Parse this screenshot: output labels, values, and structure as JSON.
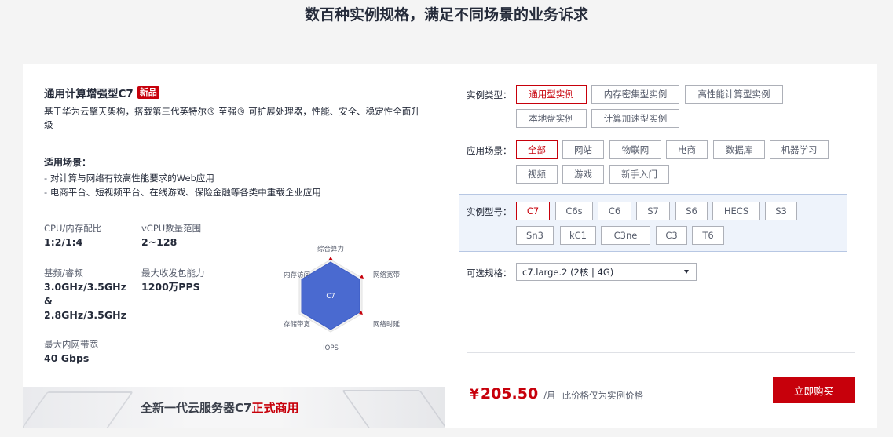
{
  "page_title": "数百种实例规格，满足不同场景的业务诉求",
  "product": {
    "title": "通用计算增强型C7",
    "badge": "新品",
    "description": "基于华为云擎天架构，搭载第三代英特尔® 至强® 可扩展处理器，性能、安全、稳定性全面升级",
    "scenario_title": "适用场景：",
    "scenarios": [
      "对计算与网络有较高性能要求的Web应用",
      "电商平台、短视频平台、在线游戏、保险金融等各类中重载企业应用"
    ],
    "specs": [
      {
        "key": "CPU/内存配比",
        "value": "1:2/1:4"
      },
      {
        "key": "vCPU数量范围",
        "value": "2~128"
      },
      {
        "key": "基频/睿频",
        "value": "3.0GHz/3.5GHz & 2.8GHz/3.5GHz"
      },
      {
        "key": "最大收发包能力",
        "value": "1200万PPS"
      },
      {
        "key": "最大内网带宽",
        "value": "40 Gbps"
      }
    ],
    "radar": {
      "center_label": "C7",
      "axes": [
        "综合算力",
        "网络宽带",
        "网络时延",
        "IOPS",
        "存储带宽",
        "内存访问"
      ],
      "fill_color": "#4a6ad0"
    },
    "banner": {
      "text_prefix": "全新一代云服务器C7",
      "text_highlight": "正式商用"
    }
  },
  "filters": {
    "instance_type": {
      "label": "实例类型：",
      "options": [
        "通用型实例",
        "内存密集型实例",
        "高性能计算型实例",
        "本地盘实例",
        "计算加速型实例"
      ],
      "selected": "通用型实例"
    },
    "scenario": {
      "label": "应用场景：",
      "options": [
        "全部",
        "网站",
        "物联网",
        "电商",
        "数据库",
        "机器学习",
        "视频",
        "游戏",
        "新手入门"
      ],
      "selected": "全部"
    },
    "model": {
      "label": "实例型号：",
      "options": [
        "C7",
        "C6s",
        "C6",
        "S7",
        "S6",
        "HECS",
        "S3",
        "Sn3",
        "kC1",
        "C3ne",
        "C3",
        "T6"
      ],
      "selected": "C7"
    },
    "spec": {
      "label": "可选规格：",
      "value": "c7.large.2 (2核 | 4G)"
    }
  },
  "pricing": {
    "currency": "¥",
    "amount": "205.50",
    "unit": "/月",
    "note": "此价格仅为实例价格",
    "buy_label": "立即购买"
  },
  "colors": {
    "brand_red": "#c7000b",
    "model_box_bg": "#eef3fb"
  }
}
